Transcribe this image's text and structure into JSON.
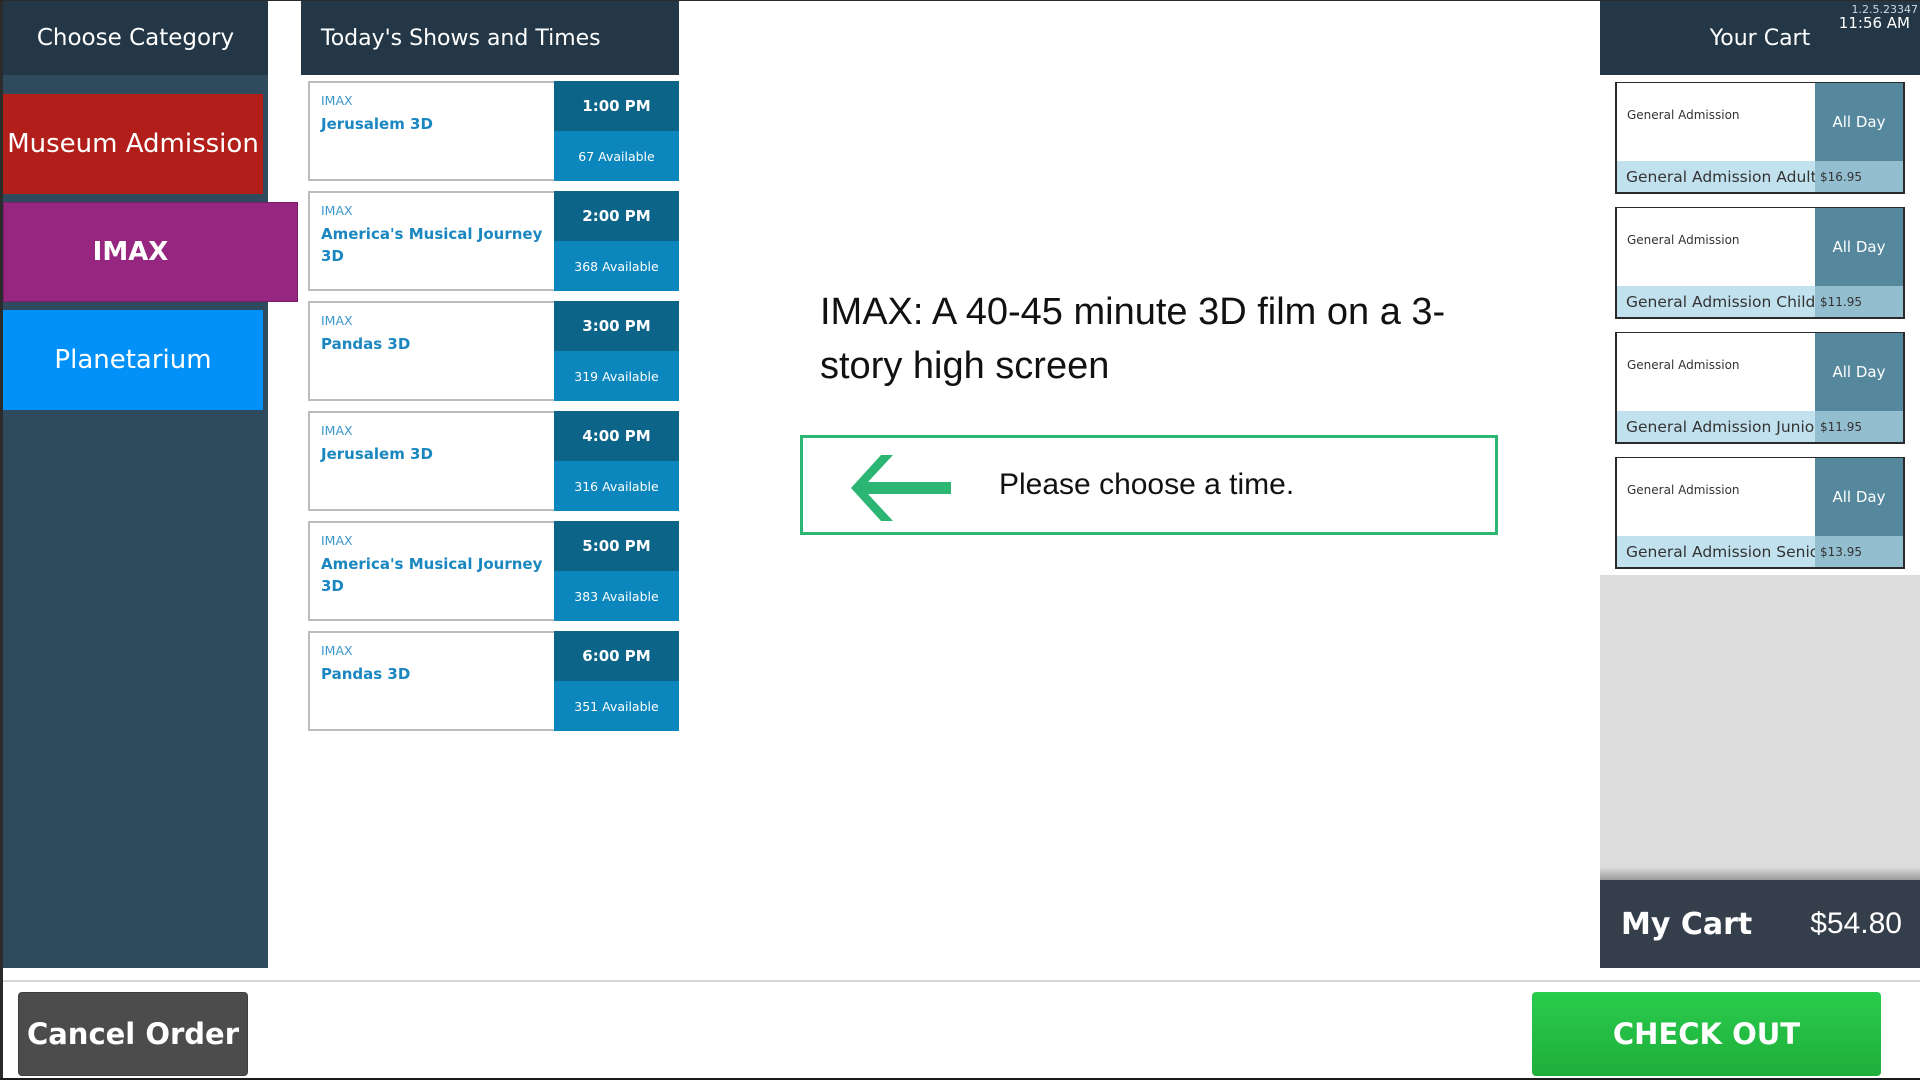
{
  "sidebar": {
    "header": "Choose Category",
    "categories": [
      {
        "label": "Museum Admission",
        "color": "#b21f1a",
        "selected": false
      },
      {
        "label": "IMAX",
        "color": "#96267f",
        "selected": true
      },
      {
        "label": "Planetarium",
        "color": "#0291f8",
        "selected": false
      }
    ]
  },
  "shows": {
    "header": "Today's Shows and Times",
    "items": [
      {
        "category": "IMAX",
        "title": "Jerusalem 3D",
        "time": "1:00 PM",
        "available": "67 Available"
      },
      {
        "category": "IMAX",
        "title": "America's Musical Journey 3D",
        "time": "2:00 PM",
        "available": "368 Available"
      },
      {
        "category": "IMAX",
        "title": "Pandas 3D",
        "time": "3:00 PM",
        "available": "319 Available"
      },
      {
        "category": "IMAX",
        "title": "Jerusalem 3D",
        "time": "4:00 PM",
        "available": "316 Available"
      },
      {
        "category": "IMAX",
        "title": "America's Musical Journey 3D",
        "time": "5:00 PM",
        "available": "383 Available"
      },
      {
        "category": "IMAX",
        "title": "Pandas 3D",
        "time": "6:00 PM",
        "available": "351 Available"
      }
    ]
  },
  "center": {
    "description": "IMAX: A 40-45 minute 3D film on a 3-story high screen",
    "prompt": "Please choose a time.",
    "arrow_icon": "arrow-left-icon",
    "accent_color": "#2bb673"
  },
  "cart": {
    "header": "Your Cart",
    "version": "1.2.5.23347",
    "clock": "11:56 AM",
    "items": [
      {
        "category": "General Admission",
        "slot": "All Day",
        "name": "General Admission Adult",
        "price": "$16.95"
      },
      {
        "category": "General Admission",
        "slot": "All Day",
        "name": "General Admission Child",
        "price": "$11.95"
      },
      {
        "category": "General Admission",
        "slot": "All Day",
        "name": "General Admission Junior",
        "price": "$11.95"
      },
      {
        "category": "General Admission",
        "slot": "All Day",
        "name": "General Admission Senior",
        "price": "$13.95"
      }
    ],
    "total_label": "My Cart",
    "total_value": "$54.80"
  },
  "footer": {
    "cancel_label": "Cancel Order",
    "checkout_label": "CHECK OUT",
    "checkout_color": "#25c047"
  }
}
